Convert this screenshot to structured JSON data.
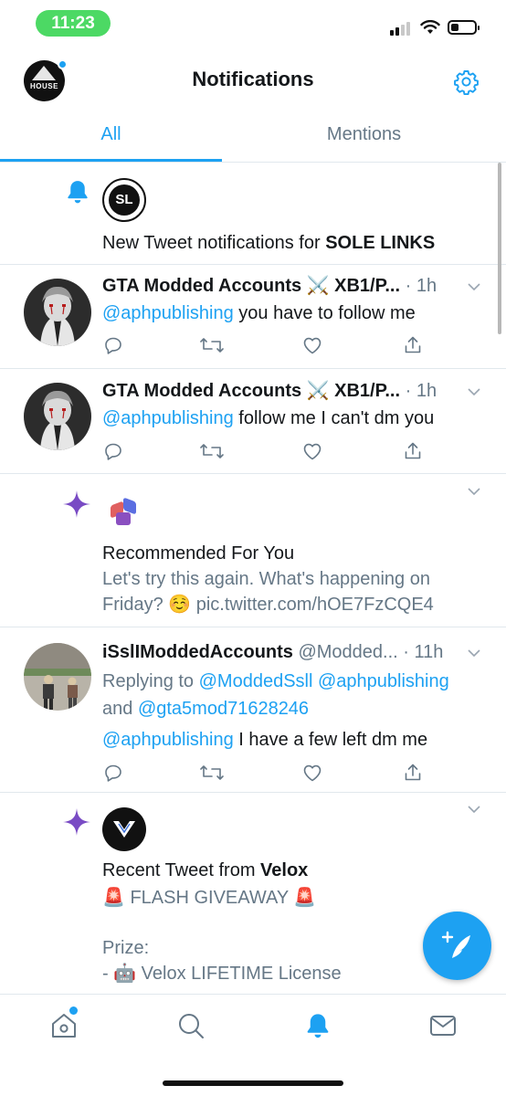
{
  "status_bar": {
    "time": "11:23",
    "battery_level": 0.35
  },
  "header": {
    "title": "Notifications",
    "avatar_text": "HOUSE"
  },
  "tabs": [
    {
      "label": "All",
      "active": true
    },
    {
      "label": "Mentions",
      "active": false
    }
  ],
  "notifications": [
    {
      "kind": "tweet_alert",
      "text_prefix": "New Tweet notifications for ",
      "text_bold": "SOLE LINKS",
      "avatar_text": "SL"
    },
    {
      "kind": "tweet",
      "name": "GTA Modded Accounts ⚔️ XB1/P...",
      "time": "· 1h",
      "mention": "@aphpublishing",
      "body": " you have to follow me"
    },
    {
      "kind": "tweet",
      "name": "GTA Modded Accounts ⚔️ XB1/P...",
      "time": "· 1h",
      "mention": "@aphpublishing",
      "body": " follow me I can't dm you"
    },
    {
      "kind": "recommended",
      "title": "Recommended For You",
      "line1": "Let's try this again. What's happening on",
      "line2_pre": "Friday? ☺️ ",
      "link": "pic.twitter.com/hOE7FzCQE4"
    },
    {
      "kind": "reply",
      "name": "iSslIModdedAccounts",
      "handle": "@Modded...",
      "time": "· 11h",
      "replying_label": "Replying to ",
      "replying_to_1": "@ModdedSsll",
      "replying_to_2": "@aphpublishing",
      "and_label": "and ",
      "replying_to_3": "@gta5mod71628246",
      "mention": "@aphpublishing",
      "body": " I have a few left dm me"
    },
    {
      "kind": "recent",
      "title_prefix": "Recent Tweet from ",
      "title_bold": "Velox",
      "line1": "🚨  FLASH GIVEAWAY  🚨",
      "prize_label": "Prize:",
      "prize_item": "- 🤖  Velox LIFETIME License"
    }
  ],
  "colors": {
    "accent": "#1da1f2",
    "muted": "#657786",
    "spark": "#794bc4",
    "battery": "#111111"
  },
  "icons": [
    "reply-icon",
    "retweet-icon",
    "like-icon",
    "share-icon",
    "home-icon",
    "search-icon",
    "notifications-icon",
    "messages-icon",
    "compose-icon",
    "gear-icon",
    "bell-icon",
    "sparkle-icon",
    "chevron-down-icon"
  ]
}
